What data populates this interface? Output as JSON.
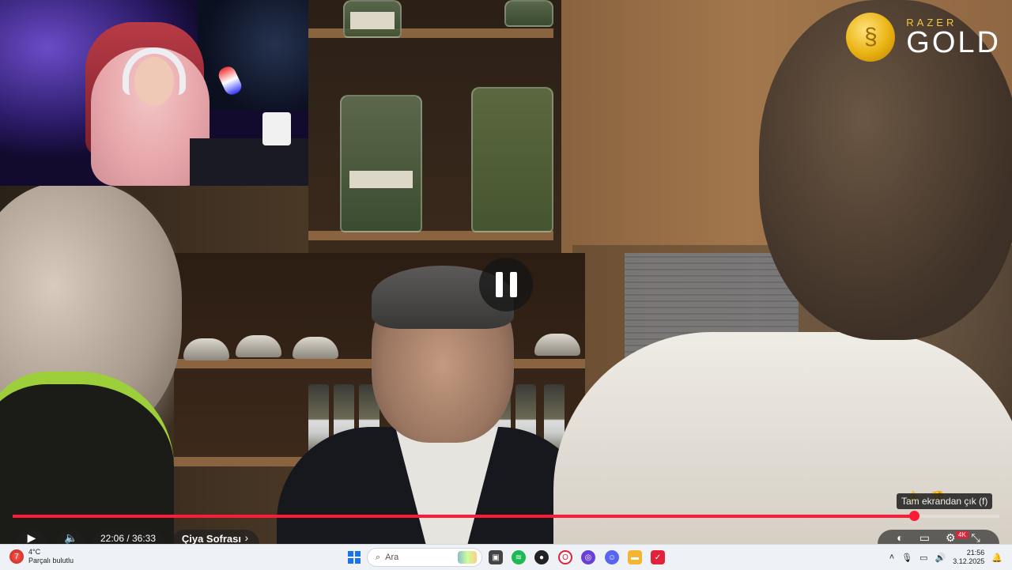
{
  "brand": {
    "top": "RAZER",
    "bottom": "GOLD"
  },
  "player": {
    "time": "22:06 / 36:33",
    "title": "Çiya Sofrası",
    "progress_fraction": 0.9136,
    "exit_fullscreen_tooltip": "Tam ekrandan çık (f)",
    "quality_badge": "4K"
  },
  "taskbar": {
    "weather_temp": "4°C",
    "weather_desc": "Parçalı bulutlu",
    "search_placeholder": "Ara",
    "time": "21:56",
    "date": "3.12.2025"
  },
  "colors": {
    "progress": "#ff1a35",
    "taskbar_bg": "#eef1f6",
    "brand_gold": "#f2c744"
  },
  "icons": [
    "pause-icon",
    "play-icon",
    "volume-icon",
    "like-icon",
    "dislike-icon",
    "comment-icon",
    "share-icon",
    "settings-icon",
    "fullscreen-exit-icon"
  ]
}
